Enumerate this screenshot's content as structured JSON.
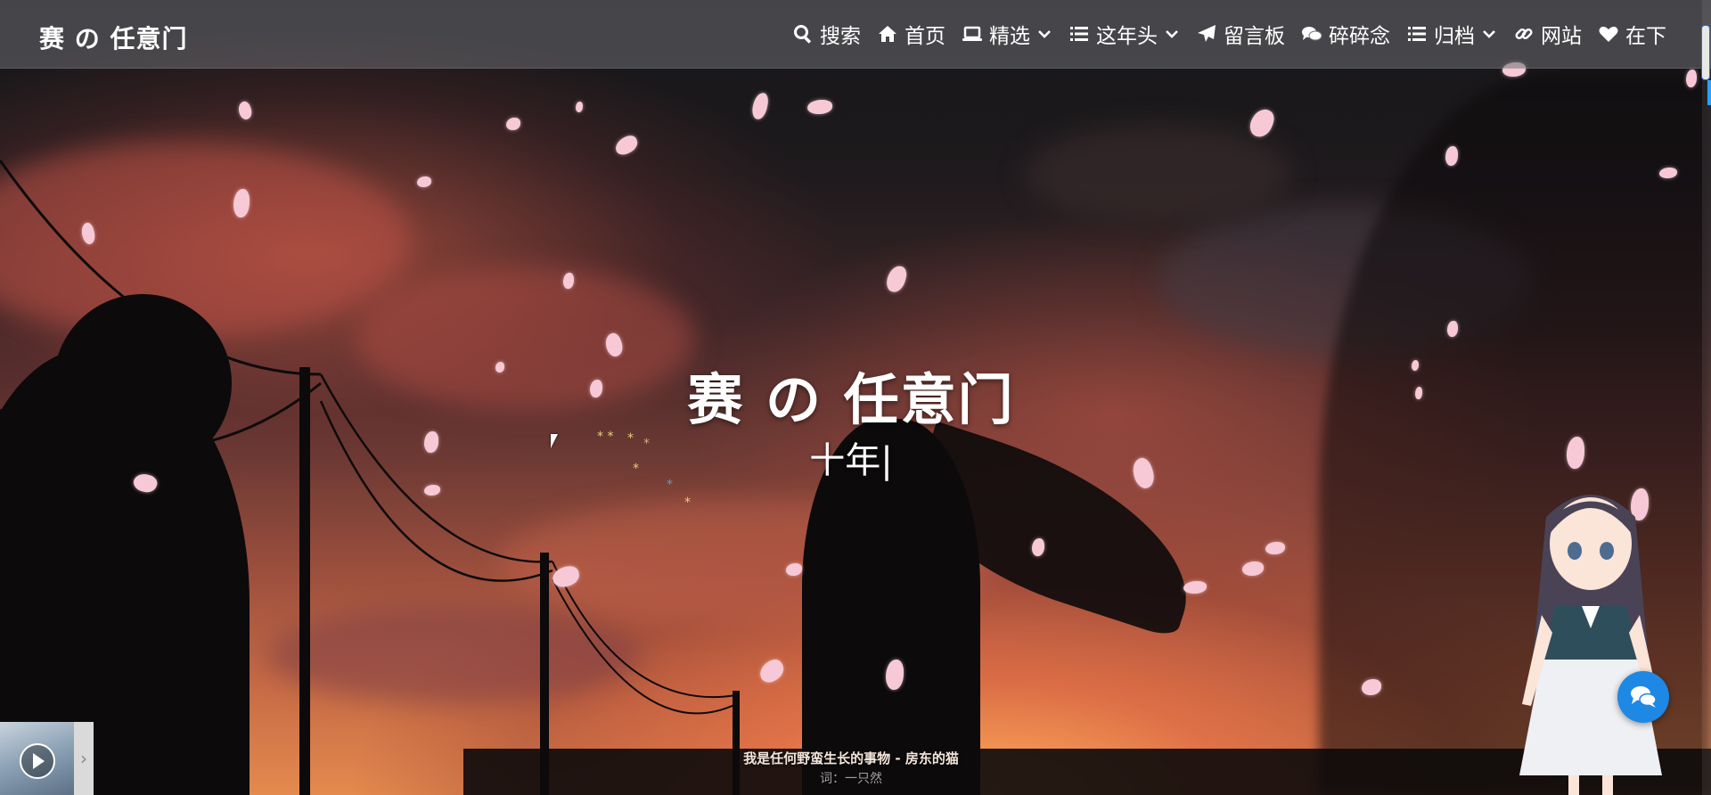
{
  "nav": {
    "brand": "赛 の 任意门",
    "items": [
      {
        "icon": "search-icon",
        "label": "搜索",
        "dropdown": false
      },
      {
        "icon": "home-icon",
        "label": "首页",
        "dropdown": false
      },
      {
        "icon": "laptop-icon",
        "label": "精选",
        "dropdown": true
      },
      {
        "icon": "list-icon",
        "label": "这年头",
        "dropdown": true
      },
      {
        "icon": "paper-plane-icon",
        "label": "留言板",
        "dropdown": false
      },
      {
        "icon": "comments-icon",
        "label": "碎碎念",
        "dropdown": false
      },
      {
        "icon": "list-icon",
        "label": "归档",
        "dropdown": true
      },
      {
        "icon": "link-icon",
        "label": "网站",
        "dropdown": false
      },
      {
        "icon": "heart-icon",
        "label": "在下",
        "dropdown": false
      }
    ]
  },
  "hero": {
    "title": "赛 の 任意门",
    "subtitle": "十年|"
  },
  "quote": {
    "text": "我是任何野蛮生长的事物 - 房东的猫",
    "author": "词：一只然"
  },
  "player": {
    "cover_icon": "play-icon",
    "toggle_icon": "chevron-right-icon",
    "toggle_glyph": "›"
  },
  "widgets": {
    "chat_icon": "chat-bubbles-icon",
    "accent": "#1e88e5"
  }
}
